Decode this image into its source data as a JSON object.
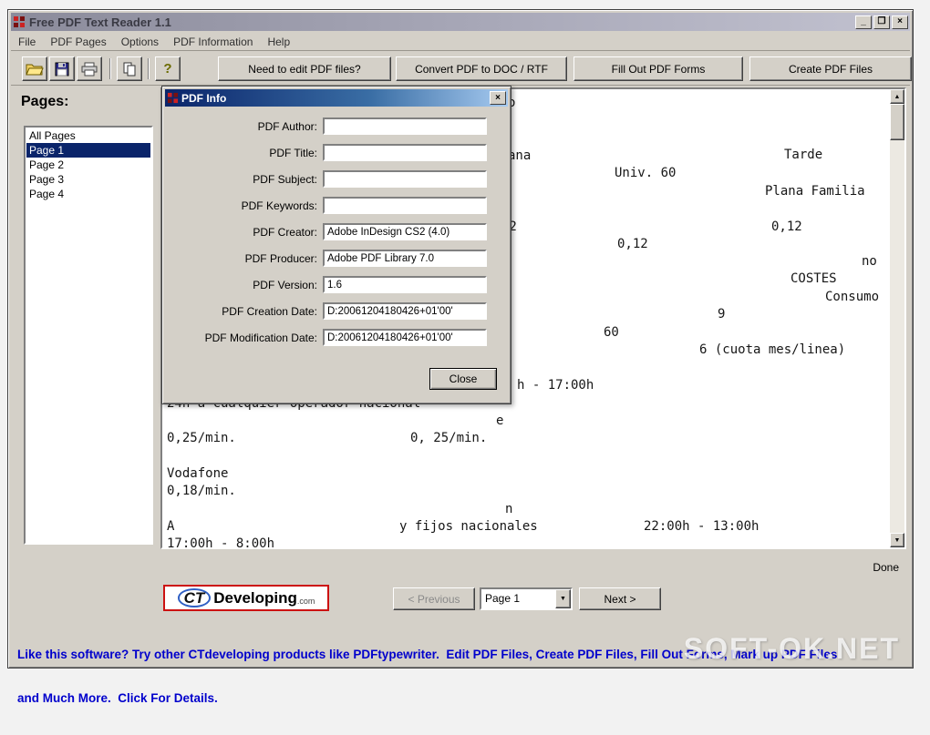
{
  "window": {
    "title": "Free PDF Text Reader 1.1",
    "controls": {
      "minimize": "_",
      "maximize": "❐",
      "close": "×"
    }
  },
  "menu": {
    "items": [
      "File",
      "PDF Pages",
      "Options",
      "PDF Information",
      "Help"
    ]
  },
  "toolbar": {
    "icon_names": [
      "open-icon",
      "save-icon",
      "print-icon",
      "copy-icon",
      "help-icon"
    ],
    "help_glyph": "?",
    "buttons": [
      "Need to edit PDF files?",
      "Convert PDF to DOC / RTF",
      "Fill Out PDF Forms",
      "Create PDF Files"
    ]
  },
  "sidebar": {
    "label": "Pages:",
    "items": [
      "All Pages",
      "Page 1",
      "Page 2",
      "Page 3",
      "Page 4"
    ],
    "selected": "Page 1"
  },
  "document": {
    "fragments": [
      "o",
      "ana",
      "Tarde",
      "Univ. 60",
      "Plana Familia",
      ".2",
      "0,12",
      "0,12",
      "no",
      "COSTES",
      "Consumo",
      "9",
      "60",
      "6 (cuota mes/linea)",
      "h - 17:00h",
      "24h a cualquier operador nacional",
      "e",
      "0,25/min.",
      "0, 25/min.",
      "Vodafone",
      "0,18/min.",
      "n",
      "A",
      "y fijos nacionales",
      "22:00h - 13:00h",
      "17:00h - 8:00h"
    ]
  },
  "scrollbar": {
    "up": "▲",
    "down": "▼"
  },
  "dialog": {
    "title": "PDF Info",
    "close_icon": "×",
    "fields": [
      {
        "label": "PDF Author:",
        "value": ""
      },
      {
        "label": "PDF Title:",
        "value": ""
      },
      {
        "label": "PDF Subject:",
        "value": ""
      },
      {
        "label": "PDF Keywords:",
        "value": ""
      },
      {
        "label": "PDF Creator:",
        "value": "Adobe InDesign CS2 (4.0)"
      },
      {
        "label": "PDF Producer:",
        "value": "Adobe PDF Library 7.0"
      },
      {
        "label": "PDF Version:",
        "value": "1.6"
      },
      {
        "label": "PDF Creation Date:",
        "value": "D:20061204180426+01'00'"
      },
      {
        "label": "PDF Modification Date:",
        "value": "D:20061204180426+01'00'"
      }
    ],
    "close_button": "Close"
  },
  "status": "Done",
  "footer": {
    "logo": {
      "ct": "CT",
      "name": "Developing",
      "tld": ".com"
    },
    "previous": "< Previous",
    "page_select": "Page 1",
    "dropdown_arrow": "▼",
    "next": "Next >"
  },
  "promo": {
    "line1": "Like this software? Try other CTdeveloping products like PDFtypewriter.  Edit PDF Files, Create PDF Files, Fill Out Forms, Mark up PDF Files",
    "line2": "and Much More.  Click For Details."
  },
  "watermark": "SOFT-OK.NET",
  "colors": {
    "selection": "#0a246a",
    "promo_text": "#0000cc",
    "chrome": "#d4d0c8",
    "logo_border": "#cc1111"
  }
}
